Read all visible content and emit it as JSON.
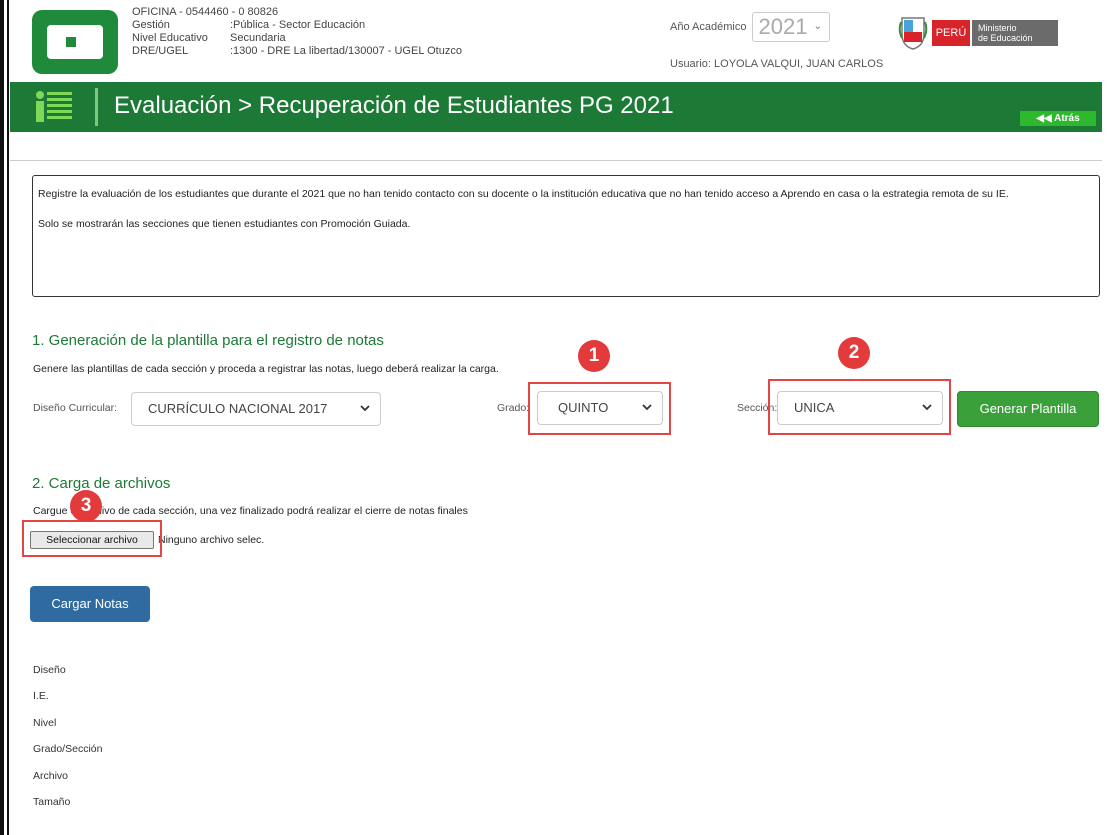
{
  "header": {
    "office_line": "OFICINA - 0544460 - 0  80826",
    "rows": [
      {
        "label": "Gestión",
        "value": ":Pública - Sector Educación"
      },
      {
        "label": "Nivel Educativo",
        "value": "Secundaria"
      },
      {
        "label": "DRE/UGEL",
        "value": ":1300 - DRE La libertad/130007 - UGEL Otuzco"
      }
    ],
    "year_label": "Año Académico",
    "year_value": "2021",
    "user_label": "Usuario:",
    "user_name": "LOYOLA VALQUI, JUAN CARLOS",
    "peru_label": "PERÚ",
    "ministry_line1": "Ministerio",
    "ministry_line2": "de Educación"
  },
  "titlebar": {
    "title": "Evaluación > Recuperación de Estudiantes PG 2021",
    "back_label": "Atrás",
    "back_icon": "double-left-arrow-icon"
  },
  "info": {
    "paragraph1": "Registre la evaluación de los estudiantes que durante el 2021 que no han tenido contacto con su docente o la institución educativa que no han tenido acceso a Aprendo en casa o la estrategia remota de su IE.",
    "paragraph2": "Solo se mostrarán las secciones que tienen estudiantes con Promoción Guiada."
  },
  "section1": {
    "title": "1. Generación de la plantilla para el registro de notas",
    "description": "Genere las plantillas de cada sección y proceda a registrar las notas, luego deberá realizar la carga.",
    "curriculum_label": "Diseño Curricular:",
    "curriculum_value": "CURRÍCULO NACIONAL 2017",
    "grade_label": "Grado:",
    "grade_value": "QUINTO",
    "section_label": "Sección:",
    "section_value": "UNICA",
    "generate_label": "Generar Plantilla"
  },
  "section2": {
    "title": "2. Carga de archivos",
    "description": "Cargue el archivo de cada sección, una vez finalizado podrá realizar el cierre de notas finales",
    "file_button": "Seleccionar archivo",
    "file_status": "Ninguno archivo selec.",
    "upload_label": "Cargar Notas"
  },
  "annotations": {
    "badge1": "1",
    "badge2": "2",
    "badge3": "3",
    "highlight_color": "#e34545"
  },
  "details": {
    "items": [
      "Diseño",
      "I.E.",
      "Nivel",
      "Grado/Sección",
      "Archivo",
      "Tamaño"
    ]
  },
  "colors": {
    "brand_green": "#1c7a36",
    "button_green": "#3aa03a",
    "button_blue": "#2f6aa0",
    "peru_red": "#d8232a"
  }
}
